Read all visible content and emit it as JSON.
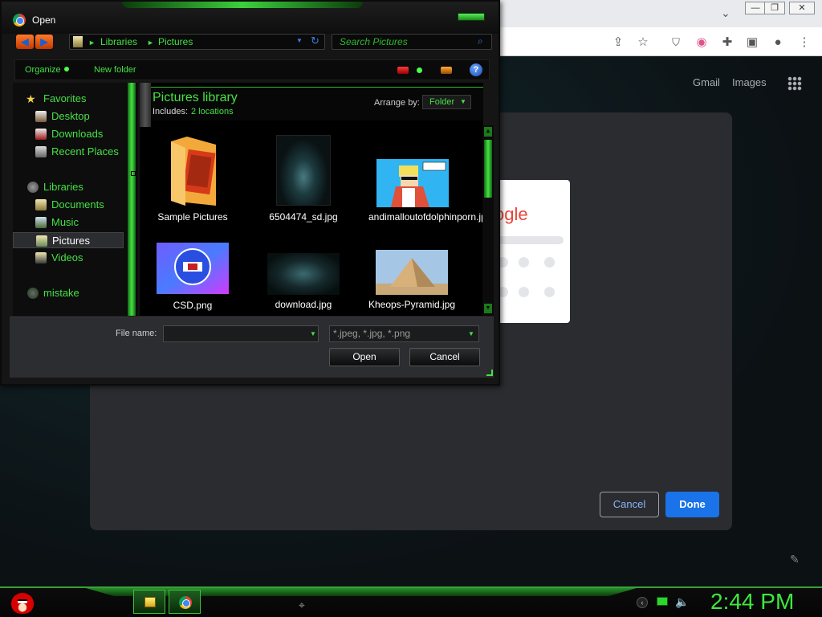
{
  "chrome": {
    "tab_chevron": "⌄",
    "window_controls": {
      "minimize": "—",
      "restore": "❐",
      "close": "✕"
    },
    "links": {
      "gmail": "Gmail",
      "images": "Images"
    },
    "preview_logo": "ogle",
    "customize_dialog": {
      "cancel": "Cancel",
      "done": "Done"
    }
  },
  "open_dialog": {
    "title": "Open",
    "address": {
      "crumbs": [
        "Libraries",
        "Pictures"
      ],
      "separator": "►"
    },
    "search_placeholder": "Search Pictures",
    "commands": {
      "organize": "Organize",
      "new_folder": "New folder",
      "help": "?"
    },
    "nav": {
      "favorites": "Favorites",
      "desktop": "Desktop",
      "downloads": "Downloads",
      "recent_places": "Recent Places",
      "libraries": "Libraries",
      "documents": "Documents",
      "music": "Music",
      "pictures": "Pictures",
      "videos": "Videos",
      "mistake": "mistake"
    },
    "library": {
      "title": "Pictures library",
      "includes_label": "Includes:",
      "locations": "2 locations",
      "arrange_label": "Arrange by:",
      "arrange_value": "Folder"
    },
    "files": [
      {
        "name": "Sample Pictures"
      },
      {
        "name": "6504474_sd.jpg"
      },
      {
        "name": "andimalloutofdolphinporn.jpg"
      },
      {
        "name": "CSD.png"
      },
      {
        "name": "download.jpg"
      },
      {
        "name": "Kheops-Pyramid.jpg"
      }
    ],
    "file_name_label": "File name:",
    "file_name_value": "",
    "file_types": "*.jpeg, *.jpg, *.png",
    "buttons": {
      "open": "Open",
      "cancel": "Cancel"
    }
  },
  "taskbar": {
    "clock": "2:44 PM"
  },
  "colors": {
    "accent_green": "#45e045",
    "chrome_blue": "#1a73e8"
  }
}
